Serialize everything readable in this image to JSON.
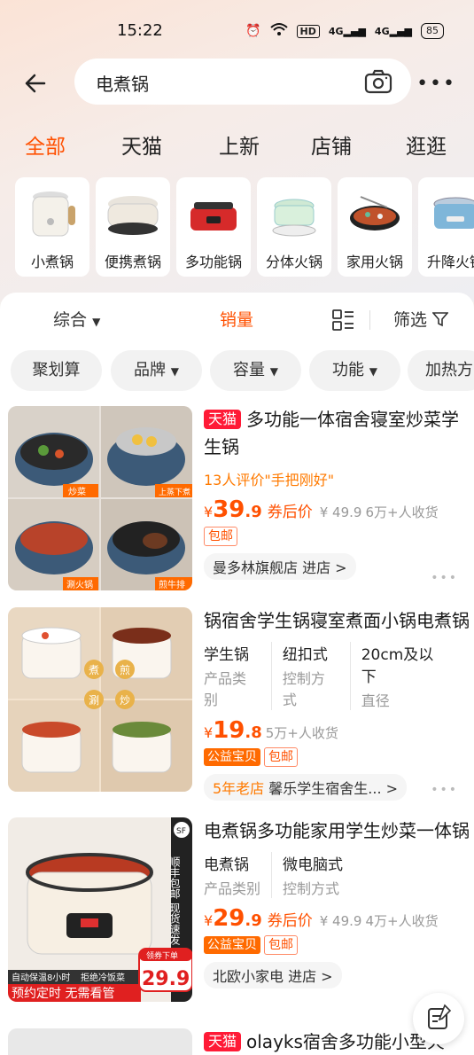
{
  "status_bar": {
    "time": "15:22",
    "hd_label": "HD",
    "net1": "4G",
    "net2": "4G",
    "battery": "85"
  },
  "search": {
    "query": "电煮锅"
  },
  "tabs": [
    {
      "label": "全部"
    },
    {
      "label": "天猫"
    },
    {
      "label": "上新"
    },
    {
      "label": "店铺"
    },
    {
      "label": "逛逛"
    }
  ],
  "categories": [
    {
      "label": "小煮锅"
    },
    {
      "label": "便携煮锅"
    },
    {
      "label": "多功能锅"
    },
    {
      "label": "分体火锅"
    },
    {
      "label": "家用火锅"
    },
    {
      "label": "升降火锅"
    }
  ],
  "sort": {
    "comprehensive": "综合",
    "sales": "销量",
    "filter": "筛选"
  },
  "chips": [
    {
      "label": "聚划算"
    },
    {
      "label": "品牌"
    },
    {
      "label": "容量"
    },
    {
      "label": "功能"
    },
    {
      "label": "加热方"
    }
  ],
  "products": [
    {
      "badge": "天猫",
      "title": "多功能一体宿舍寝室炒菜学生锅",
      "review": "13人评价\"手把刚好\"",
      "currency": "¥",
      "price_int": "39",
      "price_dec": ".9",
      "coupon": "券后价",
      "orig_price": "¥ 49.9",
      "sold": "6万+人收货",
      "tag1": "包邮",
      "shop": "曼多林旗舰店 进店 >",
      "img_labels": [
        "炒菜",
        "上蒸下煮",
        "涮火锅",
        "煎牛排"
      ]
    },
    {
      "title": "锅宿舍学生锅寝室煮面小锅电煮锅",
      "props": [
        {
          "v": "学生锅",
          "k": "产品类别"
        },
        {
          "v": "纽扣式",
          "k": "控制方式"
        },
        {
          "v": "20cm及以下",
          "k": "直径"
        }
      ],
      "currency": "¥",
      "price_int": "19",
      "price_dec": ".8",
      "sold": "5万+人收货",
      "tag_fill": "公益宝贝",
      "tag1": "包邮",
      "shop_old": "5年老店",
      "shop": "馨乐学生宿舍生... >",
      "img_labels": [
        "煮",
        "煎",
        "涮",
        "炒"
      ]
    },
    {
      "title": "电煮锅多功能家用学生炒菜一体锅",
      "props": [
        {
          "v": "电煮锅",
          "k": "产品类别"
        },
        {
          "v": "微电脑式",
          "k": "控制方式"
        }
      ],
      "currency": "¥",
      "price_int": "29",
      "price_dec": ".9",
      "coupon": "券后价",
      "orig_price": "¥ 49.9",
      "sold": "4万+人收货",
      "tag_fill": "公益宝贝",
      "tag1": "包邮",
      "shop": "北欧小家电 进店 >",
      "img_side": "顺丰包邮 现货速发",
      "img_banner1": "自动保温8小时",
      "img_banner2": "拒绝冷饭菜",
      "img_banner3": "预约定时 无需看管",
      "img_price_label": "领券下单",
      "img_price": "29.9",
      "img_sf": "SF"
    },
    {
      "badge": "天猫",
      "title": "olayks宿舍多功能小型火"
    }
  ]
}
